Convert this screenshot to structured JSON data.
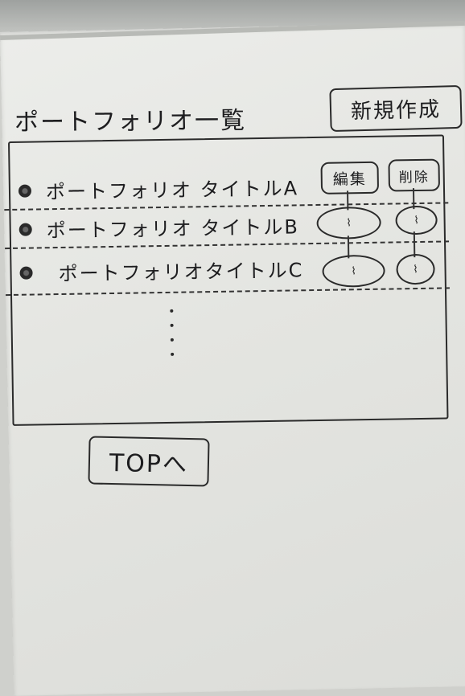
{
  "header": {
    "title": "ポートフォリオ一覧",
    "new_button_label": "新規作成"
  },
  "list": {
    "column_headers": {
      "edit": "編集",
      "delete": "削除"
    },
    "items": [
      {
        "title": "ポートフォリオ タイトルA"
      },
      {
        "title": "ポートフォリオ タイトルB"
      },
      {
        "title": "ポートフォリオタイトルC"
      }
    ]
  },
  "footer": {
    "top_button_label": "TOPへ"
  }
}
